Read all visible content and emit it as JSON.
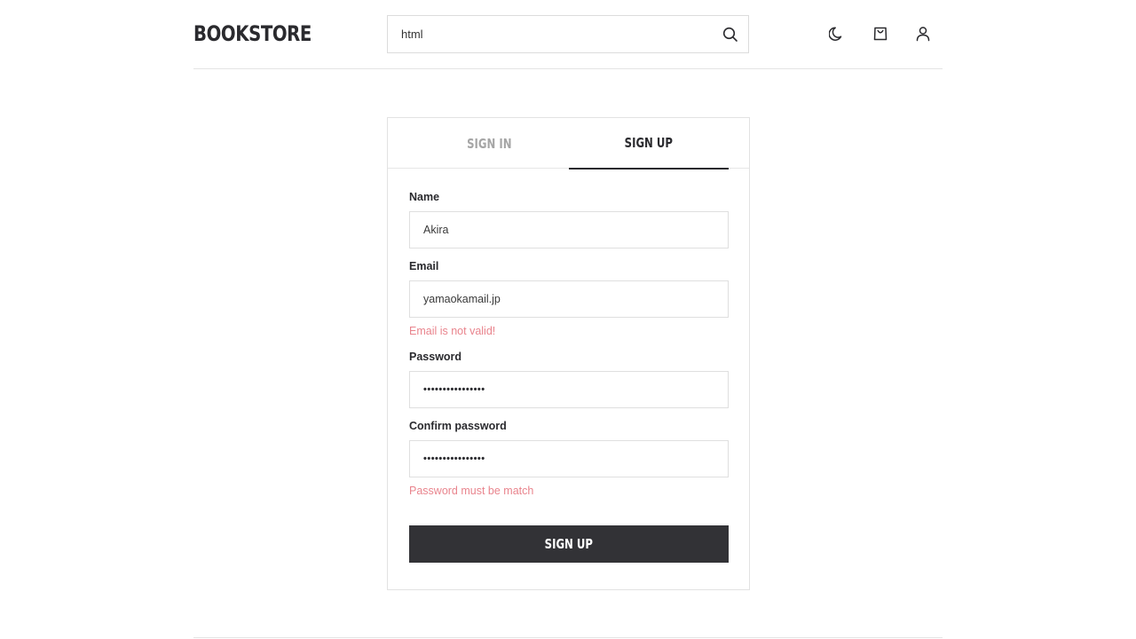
{
  "header": {
    "logo": "BOOKSTORE",
    "search": {
      "value": "html",
      "placeholder": ""
    },
    "icons": [
      "search-icon",
      "moon-icon",
      "shopping-bag-icon",
      "user-icon"
    ]
  },
  "auth": {
    "tabs": [
      {
        "label": "SIGN IN",
        "active": false
      },
      {
        "label": "SIGN UP",
        "active": true
      }
    ],
    "fields": {
      "name": {
        "label": "Name",
        "value": "Akira"
      },
      "email": {
        "label": "Email",
        "value": "yamaokamail.jp",
        "error": "Email is not valid!"
      },
      "password": {
        "label": "Password",
        "value": "••••••••••••••••"
      },
      "confirm": {
        "label": "Confirm password",
        "value": "••••••••••••••••",
        "error": "Password must be match"
      }
    },
    "submit_label": "SIGN UP"
  },
  "colors": {
    "text": "#2a2a2e",
    "muted_tab": "#a5a5a5",
    "error": "#e9848d",
    "button_bg": "#323236",
    "border": "#dfdfdf"
  }
}
